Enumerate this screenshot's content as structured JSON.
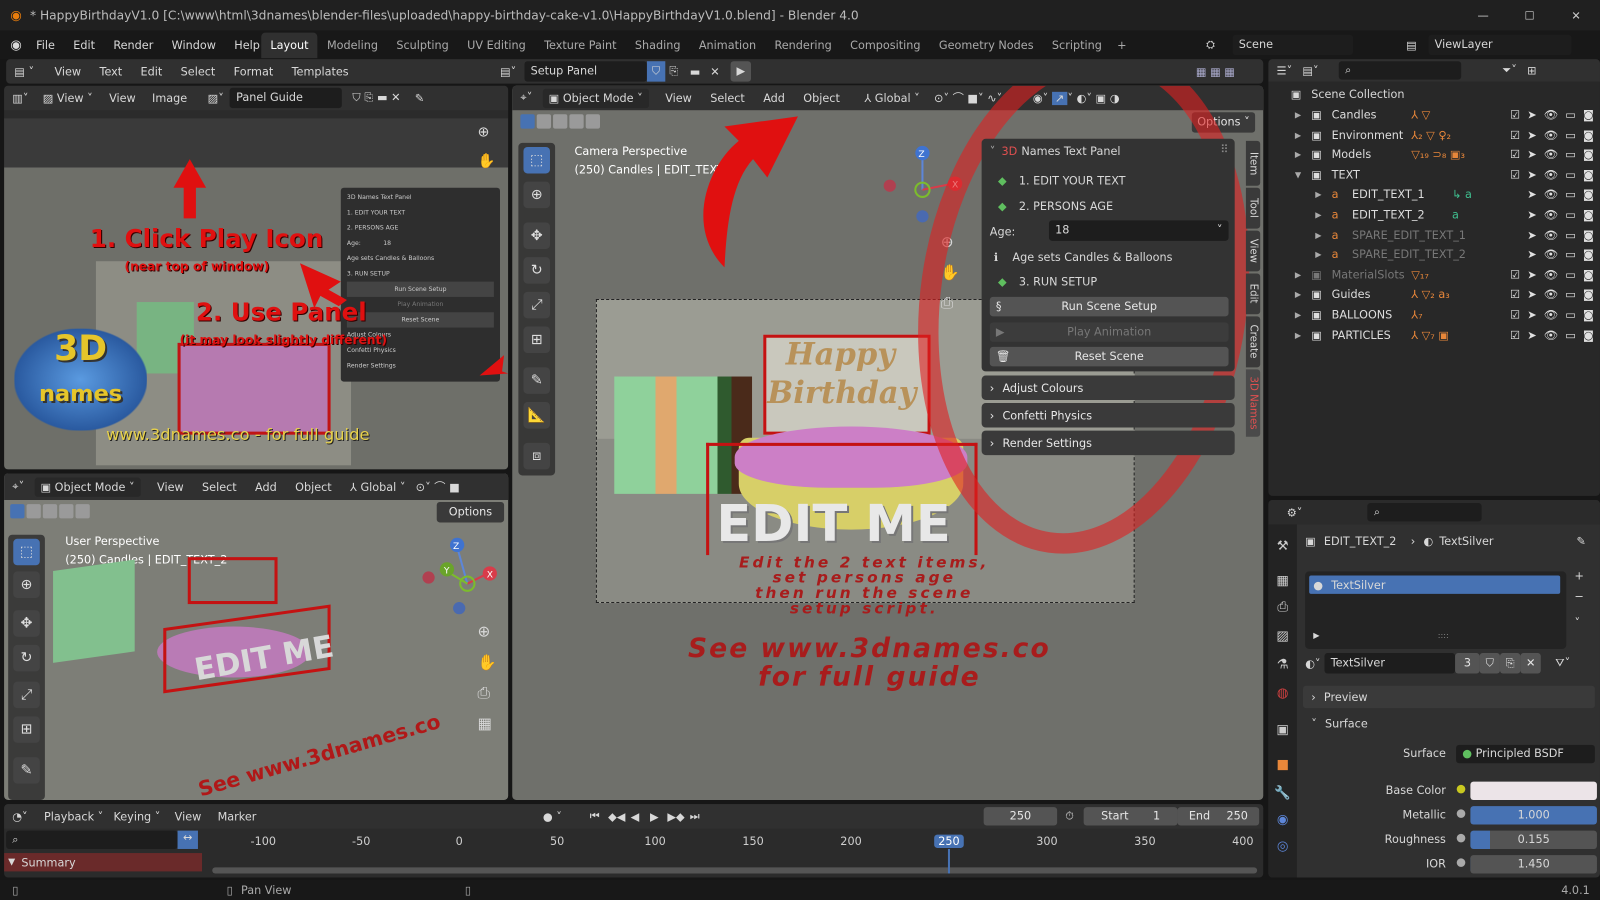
{
  "titlebar": {
    "title": "* HappyBirthdayV1.0 [C:\\www\\html\\3dnames\\blender-files\\uploaded\\happy-birthday-cake-v1.0\\HappyBirthdayV1.0.blend] - Blender 4.0"
  },
  "menubar": {
    "items": [
      "File",
      "Edit",
      "Render",
      "Window",
      "Help"
    ],
    "workspaces": [
      "Layout",
      "Modeling",
      "Sculpting",
      "UV Editing",
      "Texture Paint",
      "Shading",
      "Animation",
      "Rendering",
      "Compositing",
      "Geometry Nodes",
      "Scripting"
    ],
    "active_workspace": "Layout",
    "scene": "Scene",
    "view_layer": "ViewLayer"
  },
  "text_editor": {
    "menu": [
      "View",
      "Text",
      "Edit",
      "Select",
      "Format",
      "Templates"
    ],
    "text_name": "Setup Panel"
  },
  "image_editor": {
    "view_mode": "View",
    "menu": [
      "View",
      "Image"
    ],
    "image_name": "Panel Guide",
    "guide": {
      "step1": "1. Click Play Icon",
      "step1_sub": "(near top of window)",
      "step2": "2. Use Panel",
      "step2_sub": "(it may look slightly different)",
      "footer": "www.3dnames.co - for full guide",
      "logo": "3D names",
      "mini_panel": [
        "3D Names Text Panel",
        "1. EDIT YOUR TEXT",
        "2. PERSONS AGE",
        "Age:",
        "18",
        "Age sets Candles & Balloons",
        "3. RUN SETUP",
        "Run Scene Setup",
        "Play Animation",
        "Reset Scene",
        "Adjust Colours",
        "Confetti Physics",
        "Render Settings"
      ]
    }
  },
  "viewport_main": {
    "mode": "Object Mode",
    "menu": [
      "View",
      "Select",
      "Add",
      "Object"
    ],
    "orientation": "Global",
    "options": "Options",
    "overlay_title": "Camera Perspective",
    "overlay_sub": "(250) Candles | EDIT_TEXT_2",
    "scene_text": {
      "happy": "Happy",
      "birthday": "Birthday",
      "edit_me": "EDIT ME",
      "instructions": [
        "Edit the 2 text items,",
        "set persons age",
        "then run the scene",
        "setup script."
      ],
      "see": [
        "See www.3dnames.co",
        "for full guide"
      ]
    },
    "tabs": [
      "Item",
      "Tool",
      "View",
      "Edit",
      "Create",
      "3D Names"
    ]
  },
  "names_panel": {
    "title_prefix": "3D",
    "title": "Names Text Panel",
    "step1": "1. EDIT YOUR TEXT",
    "step2": "2. PERSONS AGE",
    "age_label": "Age:",
    "age_value": "18",
    "info": "Age sets Candles & Balloons",
    "step3": "3. RUN SETUP",
    "run_button": "Run Scene Setup",
    "play_button": "Play Animation",
    "reset_button": "Reset Scene",
    "subpanels": [
      "Adjust Colours",
      "Confetti Physics",
      "Render Settings"
    ]
  },
  "viewport_small": {
    "mode": "Object Mode",
    "menu": [
      "View",
      "Select",
      "Add",
      "Object"
    ],
    "orientation": "Global",
    "options": "Options",
    "overlay_title": "User Perspective",
    "overlay_sub": "(250) Candles | EDIT_TEXT_2"
  },
  "outliner": {
    "root": "Scene Collection",
    "rows": [
      {
        "name": "Candles",
        "icons": "⅄ ▽",
        "counts": ""
      },
      {
        "name": "Environment",
        "icons": "⅄₂ ▽ ♀₂",
        "counts": ""
      },
      {
        "name": "Models",
        "icons": "▽₁₉ ⊃₈ ▣₃",
        "counts": ""
      },
      {
        "name": "TEXT",
        "icons": "",
        "counts": ""
      },
      {
        "name": "EDIT_TEXT_1",
        "icons": "↳ a",
        "counts": ""
      },
      {
        "name": "EDIT_TEXT_2",
        "icons": "a",
        "counts": ""
      },
      {
        "name": "SPARE_EDIT_TEXT_1",
        "icons": "",
        "counts": ""
      },
      {
        "name": "SPARE_EDIT_TEXT_2",
        "icons": "",
        "counts": ""
      },
      {
        "name": "MaterialSlots",
        "icons": "▽₁₇",
        "counts": ""
      },
      {
        "name": "Guides",
        "icons": "⅄ ▽₂ a₃",
        "counts": ""
      },
      {
        "name": "BALLOONS",
        "icons": "⅄₇",
        "counts": ""
      },
      {
        "name": "PARTICLES",
        "icons": "⅄ ▽₇ ▣",
        "counts": ""
      }
    ]
  },
  "properties": {
    "breadcrumb_object": "EDIT_TEXT_2",
    "breadcrumb_material": "TextSilver",
    "slot": "TextSilver",
    "material_name": "TextSilver",
    "users": "3",
    "preview": "Preview",
    "surface_section": "Surface",
    "fields": [
      {
        "label": "Surface",
        "value": "Principled BSDF"
      },
      {
        "label": "Base Color",
        "value": ""
      },
      {
        "label": "Metallic",
        "value": "1.000"
      },
      {
        "label": "Roughness",
        "value": "0.155"
      },
      {
        "label": "IOR",
        "value": "1.450"
      }
    ],
    "metallic_fill": 1.0,
    "roughness_fill": 0.155,
    "base_color": "#ece4e8"
  },
  "timeline": {
    "menu": [
      "Playback",
      "Keying",
      "View",
      "Marker"
    ],
    "current_frame": "250",
    "start_label": "Start",
    "start": "1",
    "end_label": "End",
    "end": "250",
    "ticks": [
      "-100",
      "-50",
      "0",
      "50",
      "100",
      "150",
      "200",
      "250",
      "300",
      "350",
      "400"
    ],
    "summary": "Summary"
  },
  "statusbar": {
    "hint": "Pan View",
    "version": "4.0.1"
  },
  "colors": {
    "accent": "#4772b3",
    "annotation_red": "#e01010",
    "panel": "#303030"
  }
}
